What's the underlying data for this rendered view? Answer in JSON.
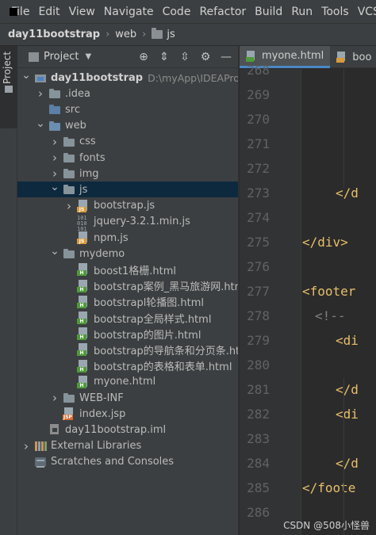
{
  "menubar": {
    "items": [
      "File",
      "Edit",
      "View",
      "Navigate",
      "Code",
      "Refactor",
      "Build",
      "Run",
      "Tools",
      "VCS"
    ]
  },
  "breadcrumb": {
    "items": [
      "day11bootstrap",
      "web",
      "js"
    ]
  },
  "toolstrip": {
    "project_tab": "Project"
  },
  "project_panel": {
    "title": "Project",
    "icons": [
      "crosshair-icon",
      "expand-icon",
      "collapse-icon",
      "gear-icon",
      "minimize-icon"
    ]
  },
  "tree": [
    {
      "label": "day11bootstrap",
      "extra": "D:\\myApp\\IDEAProject\\",
      "icon": "module",
      "arrow": "down",
      "depth": 0,
      "bold": true
    },
    {
      "label": ".idea",
      "icon": "folder",
      "arrow": "right",
      "depth": 1
    },
    {
      "label": "src",
      "icon": "folder-src",
      "arrow": "none",
      "depth": 1
    },
    {
      "label": "web",
      "icon": "folder-web",
      "arrow": "down",
      "depth": 1
    },
    {
      "label": "css",
      "icon": "folder",
      "arrow": "right",
      "depth": 2
    },
    {
      "label": "fonts",
      "icon": "folder",
      "arrow": "right",
      "depth": 2
    },
    {
      "label": "img",
      "icon": "folder",
      "arrow": "right",
      "depth": 2
    },
    {
      "label": "js",
      "icon": "folder",
      "arrow": "down",
      "depth": 2,
      "selected": true
    },
    {
      "label": "bootstrap.js",
      "icon": "js",
      "arrow": "right",
      "depth": 3
    },
    {
      "label": "jquery-3.2.1.min.js",
      "icon": "text",
      "arrow": "none",
      "depth": 3
    },
    {
      "label": "npm.js",
      "icon": "js",
      "arrow": "none",
      "depth": 3
    },
    {
      "label": "mydemo",
      "icon": "folder",
      "arrow": "down",
      "depth": 2
    },
    {
      "label": "boost1格栅.html",
      "icon": "html",
      "arrow": "none",
      "depth": 3
    },
    {
      "label": "bootstrap案例_黑马旅游网.html",
      "icon": "html",
      "arrow": "none",
      "depth": 3
    },
    {
      "label": "bootstrapl轮播图.html",
      "icon": "html",
      "arrow": "none",
      "depth": 3
    },
    {
      "label": "bootstrap全局样式.html",
      "icon": "html",
      "arrow": "none",
      "depth": 3
    },
    {
      "label": "bootstrap的图片.html",
      "icon": "html",
      "arrow": "none",
      "depth": 3
    },
    {
      "label": "bootstrap的导航条和分页条.html",
      "icon": "html",
      "arrow": "none",
      "depth": 3
    },
    {
      "label": "bootstrap的表格和表单.html",
      "icon": "html",
      "arrow": "none",
      "depth": 3
    },
    {
      "label": "myone.html",
      "icon": "html",
      "arrow": "none",
      "depth": 3
    },
    {
      "label": "WEB-INF",
      "icon": "folder",
      "arrow": "right",
      "depth": 2
    },
    {
      "label": "index.jsp",
      "icon": "jsp",
      "arrow": "none",
      "depth": 2
    },
    {
      "label": "day11bootstrap.iml",
      "icon": "iml",
      "arrow": "none",
      "depth": 1
    },
    {
      "label": "External Libraries",
      "icon": "lib",
      "arrow": "right",
      "depth": 0
    },
    {
      "label": "Scratches and Consoles",
      "icon": "scratch",
      "arrow": "none",
      "depth": 0
    }
  ],
  "editor": {
    "tabs": [
      {
        "label": "myone.html",
        "active": true
      },
      {
        "label": "boo",
        "active": false
      }
    ],
    "lines": [
      {
        "num": "268",
        "code": ""
      },
      {
        "num": "269",
        "code": ""
      },
      {
        "num": "270",
        "code": ""
      },
      {
        "num": "271",
        "code": ""
      },
      {
        "num": "272",
        "code": ""
      },
      {
        "num": "273",
        "code": "</d"
      },
      {
        "num": "274",
        "code": ""
      },
      {
        "num": "275",
        "code": "</div>"
      },
      {
        "num": "276",
        "code": ""
      },
      {
        "num": "277",
        "code": "<footer"
      },
      {
        "num": "278",
        "code": "<!--"
      },
      {
        "num": "279",
        "code": "<di"
      },
      {
        "num": "280",
        "code": ""
      },
      {
        "num": "281",
        "code": "</d"
      },
      {
        "num": "282",
        "code": "<di"
      },
      {
        "num": "283",
        "code": ""
      },
      {
        "num": "284",
        "code": "</d"
      },
      {
        "num": "285",
        "code": "</foote"
      },
      {
        "num": "286",
        "code": ""
      }
    ]
  },
  "watermark": "CSDN @508小怪兽"
}
